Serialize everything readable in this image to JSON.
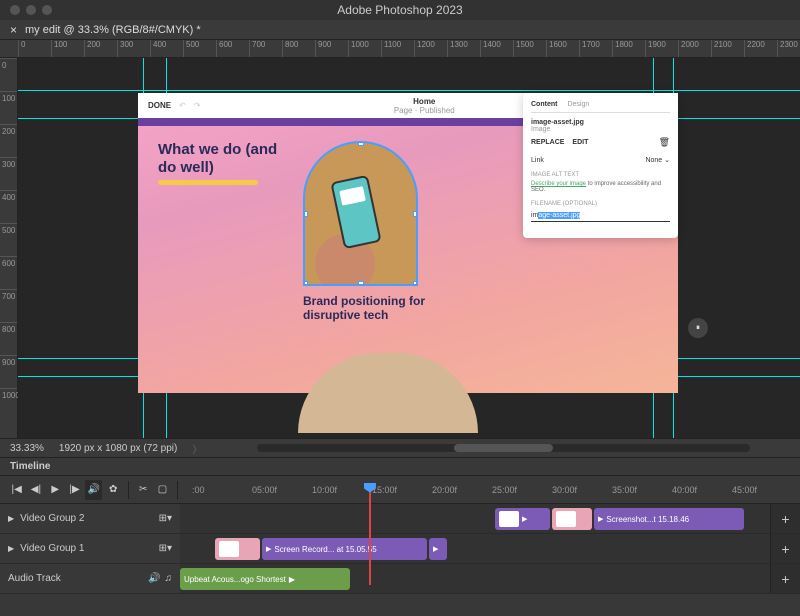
{
  "app_title": "Adobe Photoshop 2023",
  "document": {
    "tab_label": "my edit @ 33.3% (RGB/8#/CMYK) *",
    "zoom": "33.33%",
    "dimensions": "1920 px x 1080 px (72 ppi)"
  },
  "ruler_marks": [
    "0",
    "100",
    "200",
    "300",
    "400",
    "500",
    "600",
    "700",
    "800",
    "900",
    "1000",
    "1100",
    "1200",
    "1300",
    "1400",
    "1500",
    "1600",
    "1700",
    "1800",
    "1900",
    "2000",
    "2100",
    "2200",
    "2300"
  ],
  "ruler_v": [
    "0",
    "100",
    "200",
    "300",
    "400",
    "500",
    "600",
    "700",
    "800",
    "900",
    "1000"
  ],
  "canvas": {
    "done": "DONE",
    "header_title": "Home",
    "header_sub": "Page · Published",
    "heading": "What we do (and do well)",
    "subheading": "Brand positioning for disruptive tech",
    "panel": {
      "tab_content": "Content",
      "tab_design": "Design",
      "filename": "image-asset.jpg",
      "filetype": "Image",
      "replace": "REPLACE",
      "edit": "EDIT",
      "link_label": "Link",
      "link_value": "None",
      "alt_label": "IMAGE ALT TEXT",
      "alt_desc_link": "Describe your image",
      "alt_desc_rest": " to improve accessibility and SEO.",
      "filename_label": "FILENAME (OPTIONAL)",
      "filename_prefix": "im",
      "filename_selected": "age-asset.jpg"
    }
  },
  "timeline": {
    "title": "Timeline",
    "ticks": [
      ":00",
      "05:00f",
      "10:00f",
      "15:00f",
      "20:00f",
      "25:00f",
      "30:00f",
      "35:00f",
      "40:00f",
      "45:00f"
    ],
    "tracks": {
      "group2": "Video Group 2",
      "group1": "Video Group 1",
      "audio": "Audio Track"
    },
    "clips": {
      "screenshot": "Screenshot...t 15.18.46",
      "screenrec": "Screen Record... at 15.05.55",
      "audio": "Upbeat Acous...ogo Shortest"
    }
  }
}
